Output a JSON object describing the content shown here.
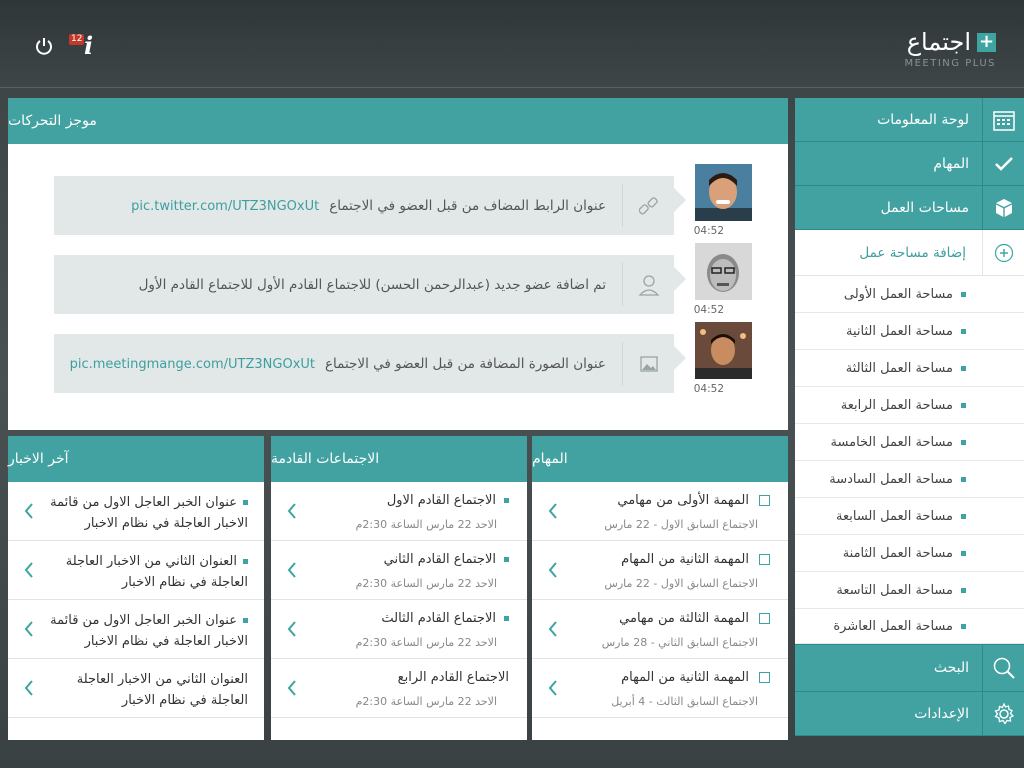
{
  "app": {
    "title": "اجتماع",
    "subtitle": "MEETING PLUS",
    "badge": "12"
  },
  "colors": {
    "accent": "#42a2a2",
    "dark": "#3b4244"
  },
  "sidebar": {
    "nav_top": [
      {
        "label": "لوحة المعلومات",
        "icon": "calendar-icon"
      },
      {
        "label": "المهام",
        "icon": "check-icon"
      },
      {
        "label": "مساحات العمل",
        "icon": "cube-icon"
      }
    ],
    "add_workspace": "إضافة مساحة عمل",
    "workspaces": [
      "مساحة العمل الأولى",
      "مساحة العمل الثانية",
      "مساحة العمل الثالثة",
      "مساحة العمل الرابعة",
      "مساحة العمل الخامسة",
      "مساحة العمل السادسة",
      "مساحة العمل السابعة",
      "مساحة العمل الثامنة",
      "مساحة العمل التاسعة",
      "مساحة العمل العاشرة"
    ],
    "nav_bottom": [
      {
        "label": "البحث",
        "icon": "search-icon"
      },
      {
        "label": "الإعدادات",
        "icon": "gear-icon"
      }
    ]
  },
  "feed": {
    "title": "موجز التحركات",
    "items": [
      {
        "text": "عنوان الرابط المضاف من قبل العضو في الاجتماع",
        "link": "pic.twitter.com/UTZ3NGOxUt",
        "time": "04:52",
        "icon": "link-icon"
      },
      {
        "text": "تم اضافة عضو جديد (عبدالرحمن الحسن) للاجتماع القادم الأول للاجتماع القادم الأول",
        "link": "",
        "time": "04:52",
        "icon": "user-icon"
      },
      {
        "text": "عنوان الصورة المضافة من قبل العضو في الاجتماع",
        "link": "pic.meetingmange.com/UTZ3NGOxUt",
        "time": "04:52",
        "icon": "image-icon"
      }
    ]
  },
  "tasks": {
    "title": "المهام",
    "items": [
      {
        "title": "المهمة الأولى من مهامي",
        "sub": "الاجتماع السابق الاول - 22 مارس"
      },
      {
        "title": "المهمة الثانية من المهام",
        "sub": "الاجتماع السابق الاول - 22 مارس"
      },
      {
        "title": "المهمة الثالثة من مهامي",
        "sub": "الاجتماع السابق الثاني - 28 مارس"
      },
      {
        "title": "المهمة الثانية من المهام",
        "sub": "الاجتماع السابق الثالث - 4 أبريل"
      }
    ]
  },
  "meetings": {
    "title": "الاجتماعات القادمة",
    "items": [
      {
        "title": "الاجتماع القادم الاول",
        "sub": "الاحد 22 مارس  الساعة 2:30م"
      },
      {
        "title": "الاجتماع القادم الثاني",
        "sub": "الاحد 22 مارس  الساعة 2:30م"
      },
      {
        "title": "الاجتماع القادم الثالث",
        "sub": "الاحد 22 مارس  الساعة 2:30م"
      },
      {
        "title": "الاجتماع القادم الرابع",
        "sub": "الاحد 22 مارس  الساعة 2:30م"
      }
    ]
  },
  "news": {
    "title": "آخر الاخبار",
    "items": [
      {
        "text": "عنوان الخبر العاجل الاول من قائمة الاخبار العاجلة في نظام الاخبار"
      },
      {
        "text": "العنوان الثاني من الاخبار العاجلة العاجلة في نظام الاخبار"
      },
      {
        "text": "عنوان الخبر العاجل الاول من قائمة الاخبار العاجلة في نظام الاخبار"
      },
      {
        "text": "العنوان الثاني من الاخبار العاجلة العاجلة في نظام الاخبار"
      }
    ]
  }
}
